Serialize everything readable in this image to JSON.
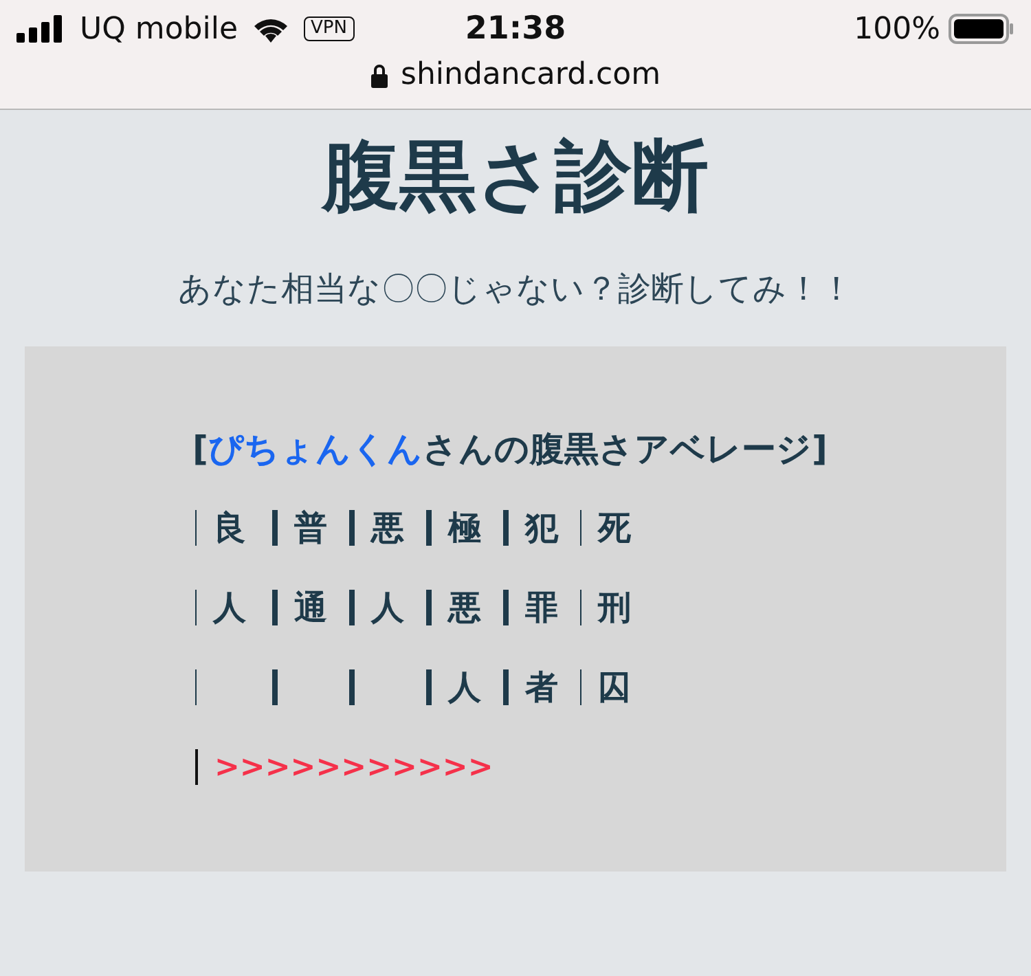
{
  "status_bar": {
    "carrier": "UQ mobile",
    "vpn": "VPN",
    "time": "21:38",
    "battery": "100%"
  },
  "address_bar": {
    "url": "shindancard.com"
  },
  "title": "腹黒さ診断",
  "subtitle": "あなた相当な〇〇じゃない？診断してみ！！",
  "result": {
    "heading": "[**ぴちょんくん**さんの腹黒さアベレージ]",
    "columns": [
      {
        "chars": [
          "良",
          "人"
        ],
        "kind": "thin"
      },
      {
        "chars": [
          "普",
          "通"
        ],
        "kind": "thick"
      },
      {
        "chars": [
          "悪",
          "人"
        ],
        "kind": "thick"
      },
      {
        "chars": [
          "極",
          "悪",
          "人"
        ],
        "kind": "thick"
      },
      {
        "chars": [
          "犯",
          "罪",
          "者"
        ],
        "kind": "thick"
      },
      {
        "chars": [
          "死",
          "刑",
          "囚"
        ],
        "kind": "thin"
      }
    ],
    "marker": ">>>>>>>>>>>"
  }
}
